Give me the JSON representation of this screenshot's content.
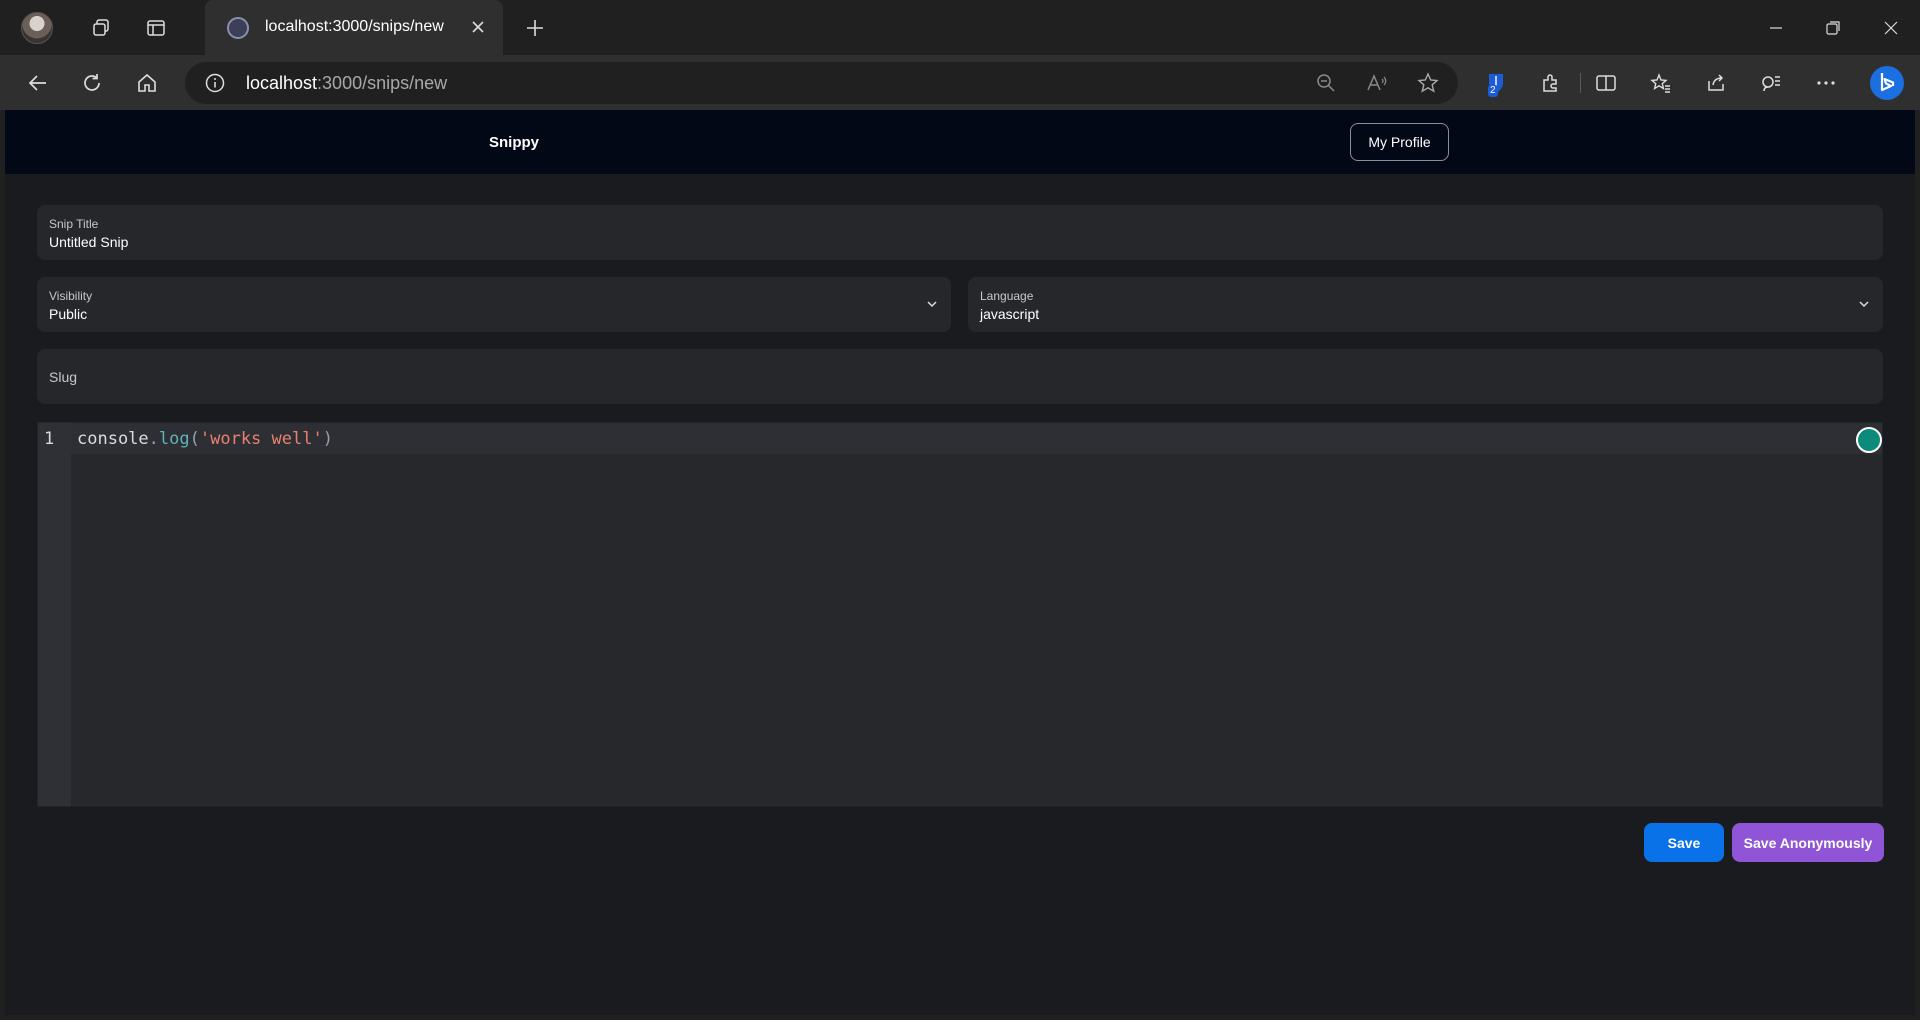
{
  "browser": {
    "tab_title": "localhost:3000/snips/new",
    "url_host": "localhost",
    "url_path": ":3000/snips/new",
    "extension_badge_count": "2"
  },
  "app": {
    "brand": "Snippy",
    "profile_button": "My Profile"
  },
  "form": {
    "title_label": "Snip Title",
    "title_value": "Untitled Snip",
    "visibility_label": "Visibility",
    "visibility_value": "Public",
    "language_label": "Language",
    "language_value": "javascript",
    "slug_placeholder": "Slug"
  },
  "editor": {
    "line_number": "1",
    "code_tokens": {
      "obj": "console",
      "dot": ".",
      "fn": "log",
      "open": "(",
      "str": "'works well'",
      "close": ")"
    }
  },
  "actions": {
    "save": "Save",
    "save_anonymously": "Save Anonymously"
  },
  "colors": {
    "header_bg": "#030816",
    "page_bg": "#1a1b1e",
    "field_bg": "#26272b",
    "save_button": "#0a72e8",
    "anon_button": "#8f55d6"
  }
}
